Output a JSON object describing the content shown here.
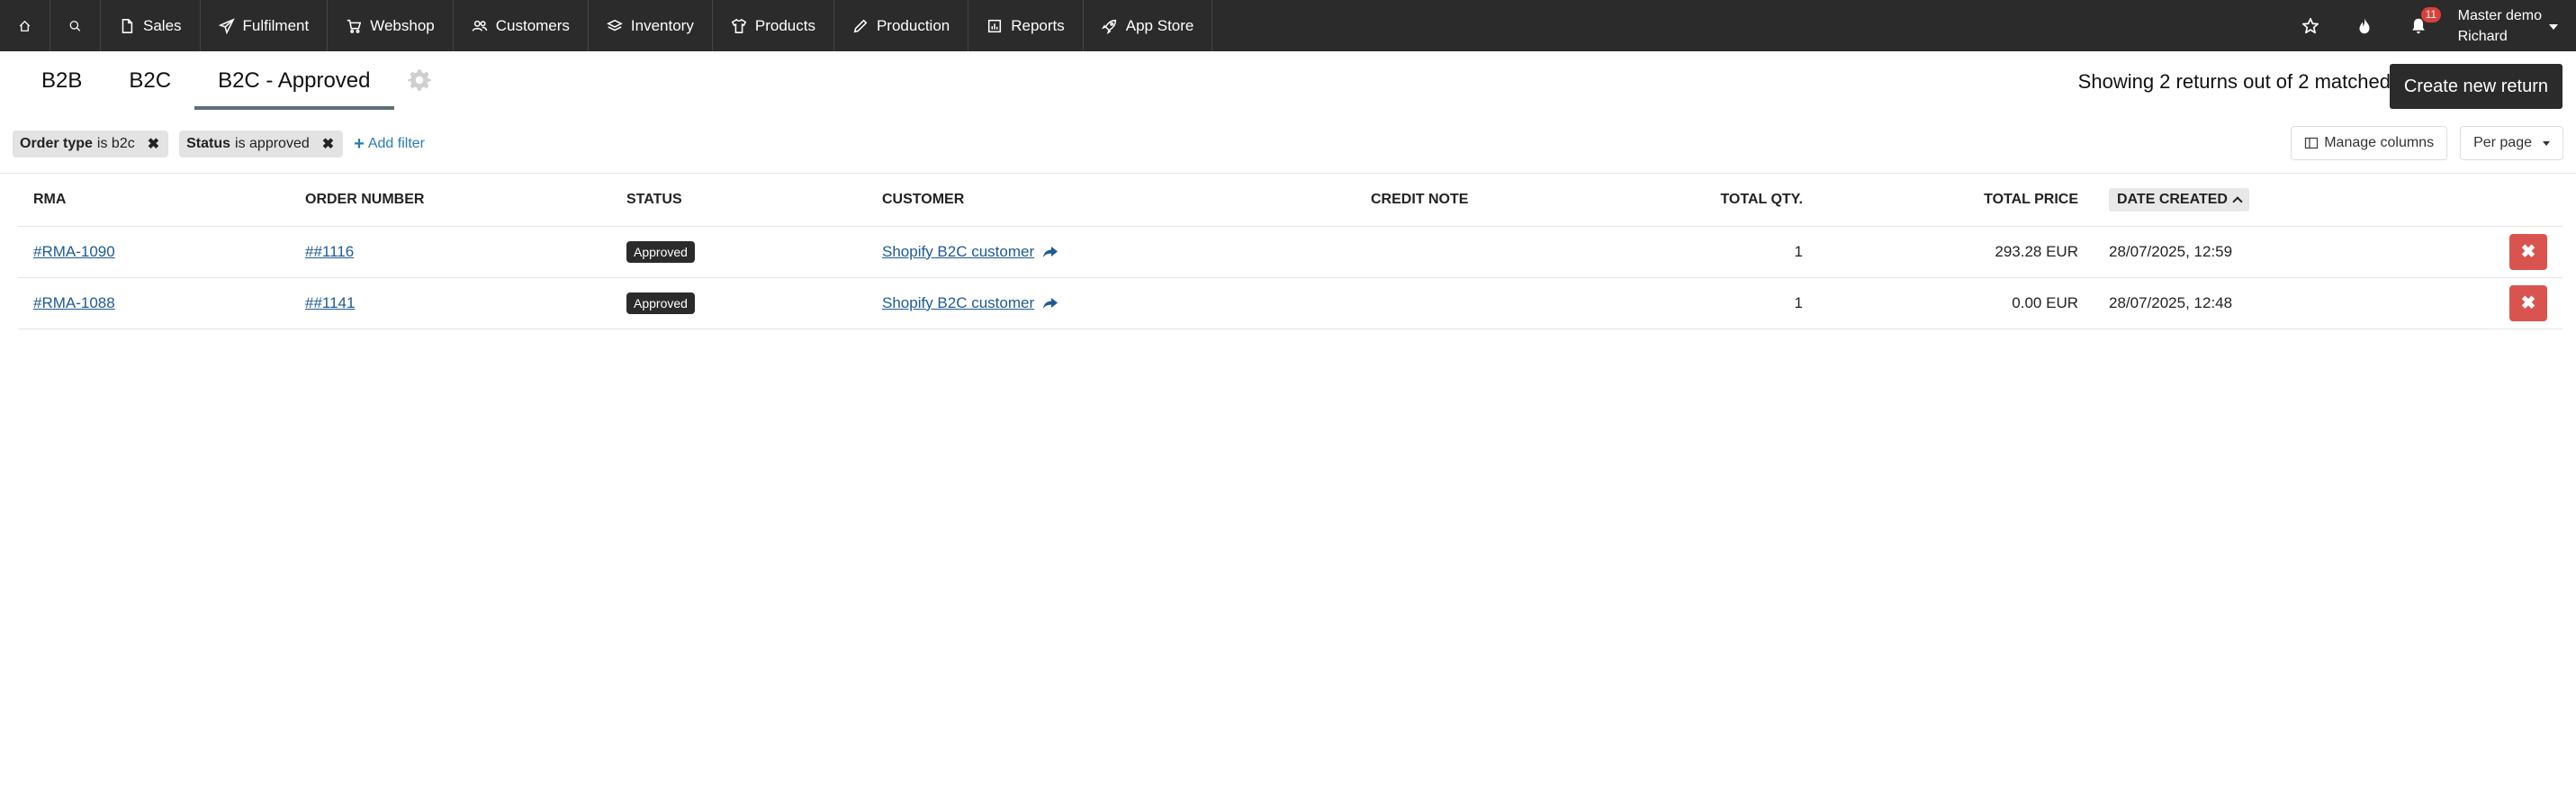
{
  "nav": {
    "home_icon": "home-icon",
    "search_icon": "search-icon",
    "items": [
      {
        "label": "Sales",
        "icon": "document-icon"
      },
      {
        "label": "Fulfilment",
        "icon": "paper-plane-icon"
      },
      {
        "label": "Webshop",
        "icon": "cart-icon"
      },
      {
        "label": "Customers",
        "icon": "users-icon"
      },
      {
        "label": "Inventory",
        "icon": "layers-icon"
      },
      {
        "label": "Products",
        "icon": "shirt-icon"
      },
      {
        "label": "Production",
        "icon": "pencil-icon"
      },
      {
        "label": "Reports",
        "icon": "chart-icon"
      },
      {
        "label": "App Store",
        "icon": "rocket-icon"
      }
    ],
    "notification_count": "11",
    "user": {
      "line1": "Master demo",
      "line2": "Richard"
    }
  },
  "tabs": [
    {
      "label": "B2B",
      "active": false
    },
    {
      "label": "B2C",
      "active": false
    },
    {
      "label": "B2C - Approved",
      "active": true
    }
  ],
  "summary": "Showing 2 returns out of 2 matched",
  "create_button": "Create new return",
  "filters": [
    {
      "field": "Order type",
      "text": "is b2c"
    },
    {
      "field": "Status",
      "text": "is approved"
    }
  ],
  "add_filter": "Add filter",
  "controls": {
    "manage_columns": "Manage columns",
    "per_page": "Per page"
  },
  "table": {
    "headers": {
      "rma": "RMA",
      "order_number": "ORDER NUMBER",
      "status": "STATUS",
      "customer": "CUSTOMER",
      "credit_note": "CREDIT NOTE",
      "total_qty": "TOTAL QTY.",
      "total_price": "TOTAL PRICE",
      "date_created": "DATE CREATED"
    },
    "rows": [
      {
        "rma": "#RMA-1090",
        "order_number": "##1116",
        "status": "Approved",
        "customer": "Shopify B2C customer",
        "credit_note": "",
        "total_qty": "1",
        "total_price": "293.28 EUR",
        "date_created": "28/07/2025, 12:59"
      },
      {
        "rma": "#RMA-1088",
        "order_number": "##1141",
        "status": "Approved",
        "customer": "Shopify B2C customer",
        "credit_note": "",
        "total_qty": "1",
        "total_price": "0.00 EUR",
        "date_created": "28/07/2025, 12:48"
      }
    ]
  },
  "colors": {
    "topbar": "#2b2b2b",
    "link": "#1d5a96",
    "delete": "#d9534f",
    "badge": "#2b2b2b"
  }
}
